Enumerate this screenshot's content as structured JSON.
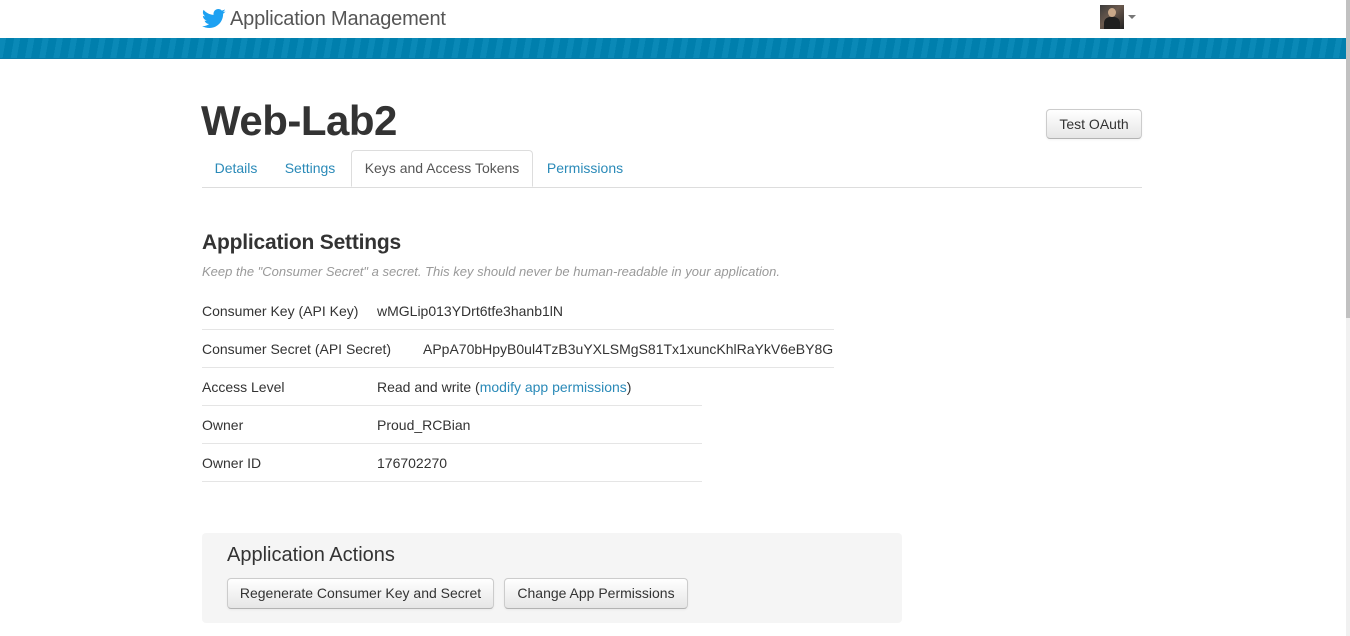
{
  "header": {
    "title": "Application Management",
    "icon": "twitter-bird-icon",
    "brand_color": "#1da1f2",
    "band_color": "#0084b4"
  },
  "app": {
    "name": "Web-Lab2",
    "test_oauth_label": "Test OAuth"
  },
  "tabs": [
    {
      "label": "Details",
      "active": false
    },
    {
      "label": "Settings",
      "active": false
    },
    {
      "label": "Keys and Access Tokens",
      "active": true
    },
    {
      "label": "Permissions",
      "active": false
    }
  ],
  "application_settings": {
    "title": "Application Settings",
    "note": "Keep the \"Consumer Secret\" a secret. This key should never be human-readable in your application.",
    "rows": [
      {
        "label": "Consumer Key (API Key)",
        "value": "wMGLip013YDrt6tfe3hanb1lN"
      },
      {
        "label": "Consumer Secret (API Secret)",
        "value": "APpA70bHpyB0ul4TzB3uYXLSMgS81Tx1xuncKhlRaYkV6eBY8G"
      },
      {
        "label": "Access Level",
        "value_prefix": "Read and write (",
        "value_link": "modify app permissions",
        "value_suffix": ")"
      },
      {
        "label": "Owner",
        "value": "Proud_RCBian"
      },
      {
        "label": "Owner ID",
        "value": "176702270"
      }
    ]
  },
  "application_actions": {
    "title": "Application Actions",
    "regenerate_label": "Regenerate Consumer Key and Secret",
    "change_permissions_label": "Change App Permissions"
  }
}
